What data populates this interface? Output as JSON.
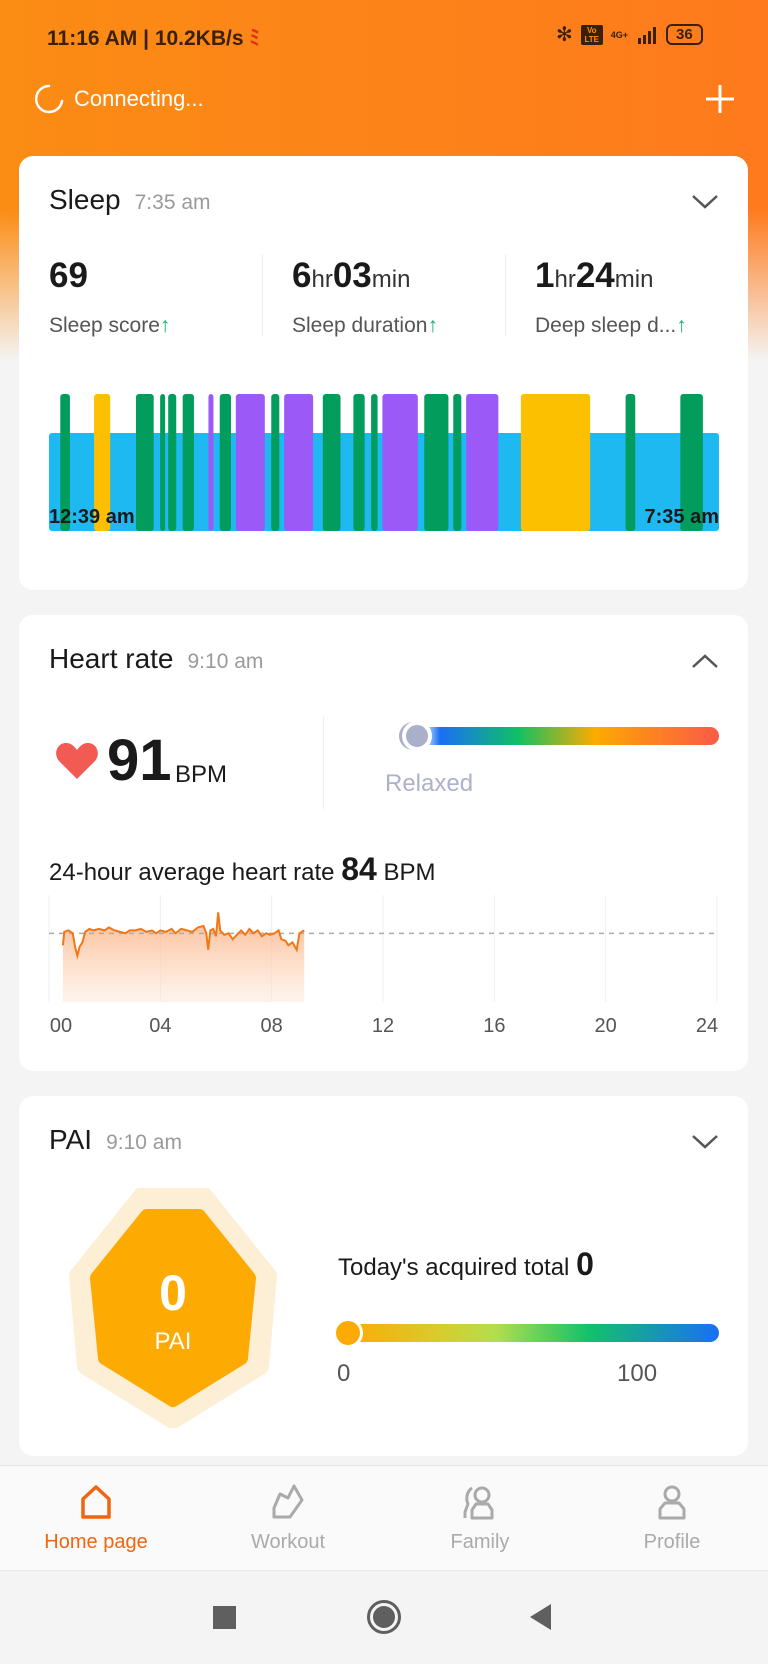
{
  "status_bar": {
    "time": "11:16 AM",
    "speed": "10.2KB/s",
    "network": "4G+",
    "volte": "Vo LTE",
    "battery": "36"
  },
  "header": {
    "connection": "Connecting...",
    "add_icon": "plus-icon"
  },
  "sleep": {
    "title": "Sleep",
    "time": "7:35 am",
    "stats": [
      {
        "value": "69",
        "label": "Sleep score"
      },
      {
        "h": "6",
        "hu": "hr",
        "m": "03",
        "mu": "min",
        "label": "Sleep duration"
      },
      {
        "h": "1",
        "hu": "hr",
        "m": "24",
        "mu": "min",
        "label": "Deep sleep d..."
      }
    ],
    "trend_arrow": "↑",
    "chart_data": {
      "type": "bar",
      "start": "12:39 am",
      "end": "7:35 am",
      "colors": {
        "light": "#1fb9f2",
        "deep": "#029c5c",
        "rem": "#9b5af8",
        "awake": "#fdc000"
      },
      "base_stage": "light",
      "segments": [
        [
          "deep",
          "12:46 am",
          "12:52 am"
        ],
        [
          "awake",
          "1:07 am",
          "1:17 am"
        ],
        [
          "deep",
          "1:33 am",
          "1:44 am"
        ],
        [
          "deep",
          "1:48 am",
          "1:50 am"
        ],
        [
          "deep",
          "1:53 am",
          "1:58 am"
        ],
        [
          "deep",
          "2:02 am",
          "2:09 am"
        ],
        [
          "rem",
          "2:18 am",
          "2:21 am"
        ],
        [
          "deep",
          "2:25 am",
          "2:32 am"
        ],
        [
          "rem",
          "2:35 am",
          "2:53 am"
        ],
        [
          "deep",
          "2:57 am",
          "3:02 am"
        ],
        [
          "rem",
          "3:05 am",
          "3:23 am"
        ],
        [
          "deep",
          "3:29 am",
          "3:40 am"
        ],
        [
          "deep",
          "3:48 am",
          "3:55 am"
        ],
        [
          "deep",
          "3:59 am",
          "4:03 am"
        ],
        [
          "rem",
          "4:06 am",
          "4:28 am"
        ],
        [
          "deep",
          "4:32 am",
          "4:47 am"
        ],
        [
          "deep",
          "4:50 am",
          "4:55 am"
        ],
        [
          "rem",
          "4:58 am",
          "5:18 am"
        ],
        [
          "awake",
          "5:32 am",
          "6:15 am"
        ],
        [
          "deep",
          "6:37 am",
          "6:43 am"
        ],
        [
          "deep",
          "7:11 am",
          "7:25 am"
        ]
      ]
    }
  },
  "heart": {
    "title": "Heart rate",
    "time": "9:10 am",
    "bpm": "91",
    "unit": "BPM",
    "state": "Relaxed",
    "gauge_level": 0,
    "avg_label": "24-hour average heart rate",
    "avg": "84",
    "avg_unit": "BPM",
    "chart_data": {
      "type": "area",
      "xlim": [
        0,
        24
      ],
      "ylim": [
        38,
        105
      ],
      "x_ticks": [
        "00",
        "04",
        "08",
        "12",
        "16",
        "20",
        "24"
      ],
      "reference_line": 84,
      "color": "#f37716",
      "points": [
        [
          0.5,
          76
        ],
        [
          0.55,
          85
        ],
        [
          0.7,
          86
        ],
        [
          0.85,
          84
        ],
        [
          0.95,
          74
        ],
        [
          1.02,
          69
        ],
        [
          1.1,
          75
        ],
        [
          1.2,
          78
        ],
        [
          1.3,
          85
        ],
        [
          1.45,
          87
        ],
        [
          1.6,
          86
        ],
        [
          1.8,
          87
        ],
        [
          2.0,
          86
        ],
        [
          2.15,
          88
        ],
        [
          2.35,
          86
        ],
        [
          2.55,
          85
        ],
        [
          2.75,
          84
        ],
        [
          2.9,
          86
        ],
        [
          3.1,
          86
        ],
        [
          3.3,
          87
        ],
        [
          3.5,
          85
        ],
        [
          3.7,
          86
        ],
        [
          3.85,
          84
        ],
        [
          4.0,
          86
        ],
        [
          4.2,
          85
        ],
        [
          4.4,
          87
        ],
        [
          4.55,
          84
        ],
        [
          4.75,
          87
        ],
        [
          4.95,
          86
        ],
        [
          5.15,
          85
        ],
        [
          5.35,
          88
        ],
        [
          5.55,
          89
        ],
        [
          5.65,
          84
        ],
        [
          5.72,
          73
        ],
        [
          5.8,
          86
        ],
        [
          5.9,
          87
        ],
        [
          6.0,
          82
        ],
        [
          6.08,
          98
        ],
        [
          6.15,
          86
        ],
        [
          6.3,
          83
        ],
        [
          6.45,
          84
        ],
        [
          6.6,
          80
        ],
        [
          6.75,
          83
        ],
        [
          6.9,
          86
        ],
        [
          7.05,
          83
        ],
        [
          7.2,
          87
        ],
        [
          7.35,
          84
        ],
        [
          7.5,
          86
        ],
        [
          7.65,
          82
        ],
        [
          7.8,
          84
        ],
        [
          7.95,
          83
        ],
        [
          8.1,
          84
        ],
        [
          8.25,
          86
        ],
        [
          8.35,
          80
        ],
        [
          8.5,
          79
        ],
        [
          8.6,
          76
        ],
        [
          8.75,
          78
        ],
        [
          8.9,
          73
        ],
        [
          9.0,
          84
        ],
        [
          9.17,
          86
        ]
      ]
    }
  },
  "pai": {
    "title": "PAI",
    "time": "9:10 am",
    "value": "0",
    "label": "PAI",
    "today_label": "Today's acquired total",
    "today_value": "0",
    "scale_min": "0",
    "scale_max": "100",
    "level": 0
  },
  "nav": {
    "items": [
      {
        "label": "Home page",
        "active": true
      },
      {
        "label": "Workout"
      },
      {
        "label": "Family"
      },
      {
        "label": "Profile"
      }
    ]
  },
  "accent": "#f0650f"
}
